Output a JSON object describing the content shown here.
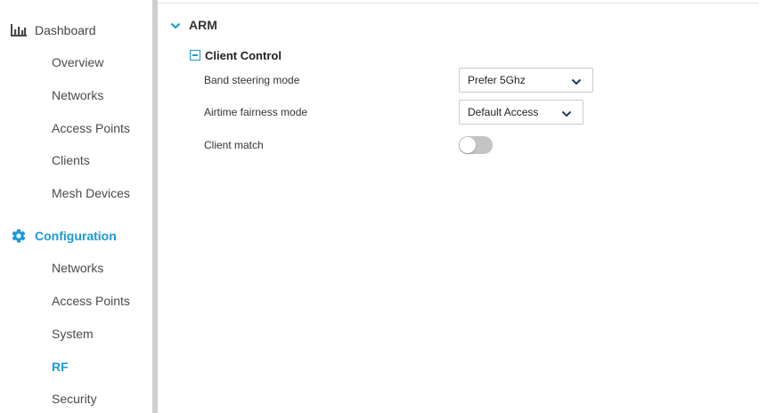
{
  "sidebar": {
    "dashboard": {
      "label": "Dashboard",
      "icon": "bar-chart-icon",
      "items": [
        "Overview",
        "Networks",
        "Access Points",
        "Clients",
        "Mesh Devices"
      ]
    },
    "configuration": {
      "label": "Configuration",
      "icon": "gear-icon",
      "items": [
        "Networks",
        "Access Points",
        "System",
        "RF",
        "Security"
      ],
      "active_item": "RF"
    }
  },
  "main": {
    "section_title": "ARM",
    "subsection_title": "Client Control",
    "band_steering": {
      "label": "Band steering mode",
      "value": "Prefer 5Ghz"
    },
    "airtime_fairness": {
      "label": "Airtime fairness mode",
      "value": "Default Access"
    },
    "client_match": {
      "label": "Client match",
      "enabled": false
    }
  },
  "colors": {
    "accent": "#1a9ad6",
    "toggle_off": "#c4c4c4",
    "divider": "#cfcfcf"
  }
}
